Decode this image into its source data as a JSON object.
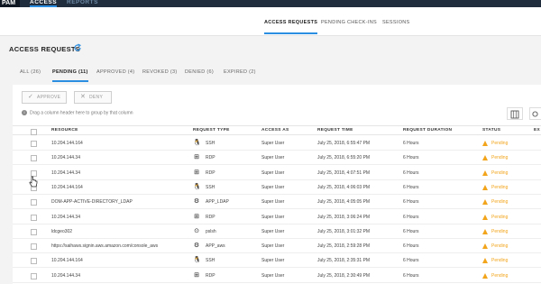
{
  "app": {
    "logo": "PAM",
    "nav": [
      "ACCESS",
      "REPORTS"
    ]
  },
  "subnav": [
    "ACCESS REQUESTS",
    "PENDING CHECK-INS",
    "SESSIONS"
  ],
  "page_title": "ACCESS REQUESTS",
  "filter_tabs": [
    "ALL (26)",
    "PENDING (11)",
    "APPROVED (4)",
    "REVOKED (3)",
    "DENIED (6)",
    "EXPIRED (2)"
  ],
  "toolbar": {
    "approve": "APPROVE",
    "deny": "DENY",
    "group_hint": "Drag a column header here to group by that column"
  },
  "columns": [
    "RESOURCE",
    "REQUEST TYPE",
    "ACCESS AS",
    "REQUEST TIME",
    "REQUEST DURATION",
    "STATUS",
    "EX"
  ],
  "colors": {
    "accent": "#2b8ee0",
    "pending": "#f2a41a",
    "topbar": "#1f2d3d"
  },
  "rows": [
    {
      "resource": "10.204.144.164",
      "type": "SSH",
      "type_icon": "linux-icon",
      "access_as": "Super User",
      "time": "July 25, 2018, 6:55:47 PM",
      "duration": "6 Hours",
      "status": "Pending"
    },
    {
      "resource": "10.204.144.34",
      "type": "RDP",
      "type_icon": "windows-icon",
      "access_as": "Super User",
      "time": "July 25, 2018, 6:55:20 PM",
      "duration": "6 Hours",
      "status": "Pending"
    },
    {
      "resource": "10.204.144.34",
      "type": "RDP",
      "type_icon": "windows-icon",
      "access_as": "Super User",
      "time": "July 25, 2018, 4:07:51 PM",
      "duration": "6 Hours",
      "status": "Pending"
    },
    {
      "resource": "10.204.144.164",
      "type": "SSH",
      "type_icon": "linux-icon",
      "access_as": "Super User",
      "time": "July 25, 2018, 4:06:03 PM",
      "duration": "6 Hours",
      "status": "Pending"
    },
    {
      "resource": "DOM-APP-ACTIVE-DIRECTORY_LDAP",
      "type": "APP_LDAP",
      "type_icon": "ldap-icon",
      "access_as": "Super User",
      "time": "July 25, 2018, 4:05:05 PM",
      "duration": "6 Hours",
      "status": "Pending"
    },
    {
      "resource": "10.204.144.34",
      "type": "RDP",
      "type_icon": "windows-icon",
      "access_as": "Super User",
      "time": "July 25, 2018, 3:06:24 PM",
      "duration": "6 Hours",
      "status": "Pending"
    },
    {
      "resource": "ldcgeo302",
      "type": "pslsh",
      "type_icon": "powershell-icon",
      "access_as": "Super User",
      "time": "July 25, 2018, 3:01:32 PM",
      "duration": "6 Hours",
      "status": "Pending"
    },
    {
      "resource": "https://saihaws.signin.aws.amazon.com/console_aws",
      "type": "APP_aws",
      "type_icon": "aws-icon",
      "access_as": "Super User",
      "time": "July 25, 2018, 2:59:28 PM",
      "duration": "6 Hours",
      "status": "Pending"
    },
    {
      "resource": "10.204.144.164",
      "type": "SSH",
      "type_icon": "linux-icon",
      "access_as": "Super User",
      "time": "July 25, 2018, 2:35:31 PM",
      "duration": "6 Hours",
      "status": "Pending"
    },
    {
      "resource": "10.204.144.34",
      "type": "RDP",
      "type_icon": "windows-icon",
      "access_as": "Super User",
      "time": "July 25, 2018, 2:30:49 PM",
      "duration": "6 Hours",
      "status": "Pending"
    }
  ]
}
